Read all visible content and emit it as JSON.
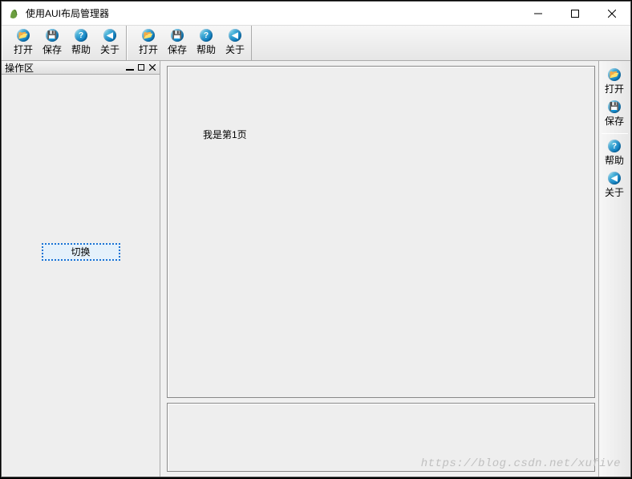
{
  "window": {
    "title": "使用AUI布局管理器"
  },
  "toolbar1": [
    {
      "label": "打开",
      "icon": "open"
    },
    {
      "label": "保存",
      "icon": "save"
    },
    {
      "label": "帮助",
      "icon": "help"
    },
    {
      "label": "关于",
      "icon": "about"
    }
  ],
  "toolbar2": [
    {
      "label": "打开",
      "icon": "open"
    },
    {
      "label": "保存",
      "icon": "save"
    },
    {
      "label": "帮助",
      "icon": "help"
    },
    {
      "label": "关于",
      "icon": "about"
    }
  ],
  "rightToolbar": [
    {
      "label": "打开",
      "icon": "open"
    },
    {
      "label": "保存",
      "icon": "save"
    },
    {
      "label": "帮助",
      "icon": "help"
    },
    {
      "label": "关于",
      "icon": "about"
    }
  ],
  "leftPanel": {
    "title": "操作区",
    "switchButton": "切换"
  },
  "content": {
    "page1Text": "我是第1页"
  },
  "watermark": "https://blog.csdn.net/xufive"
}
